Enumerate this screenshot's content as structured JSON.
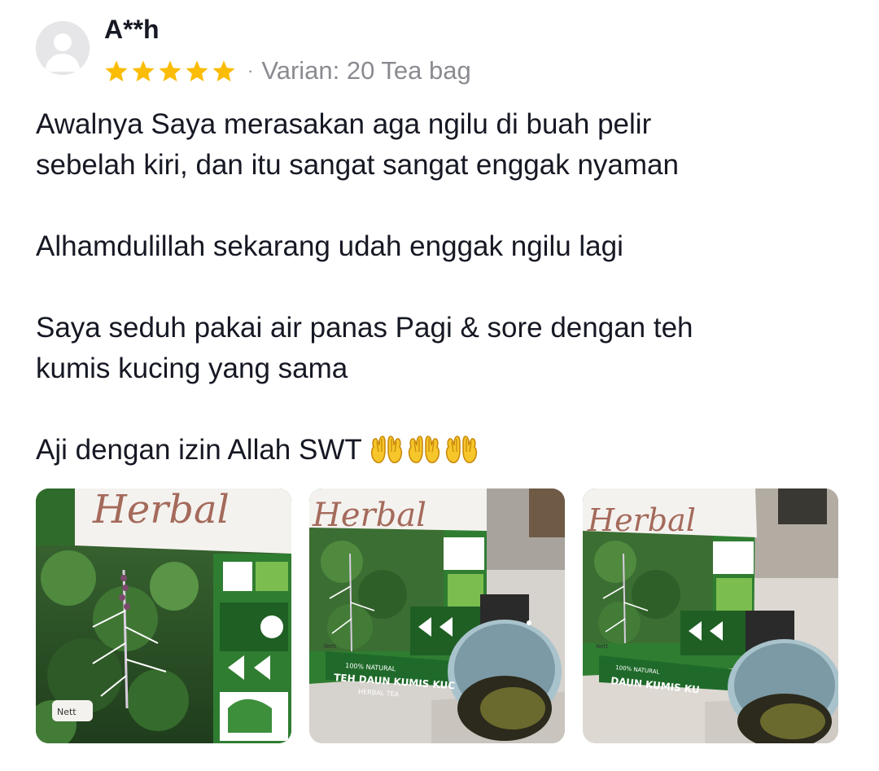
{
  "review": {
    "username": "A**h",
    "rating": 5,
    "rating_max": 5,
    "separator": "·",
    "variant": "Varian: 20 Tea bag",
    "star_color": "#FBBC05",
    "paragraphs": [
      "Awalnya Saya merasakan aga ngilu di buah pelir\nsebelah kiri, dan itu sangat sangat enggak nyaman",
      "Alhamdulillah sekarang udah enggak ngilu lagi",
      "Saya seduh pakai air panas Pagi & sore dengan teh\nkumis kucing yang sama"
    ],
    "last_line": "Aji dengan izin Allah SWT",
    "emoji": [
      "palms-up-together-emoji",
      "palms-up-together-emoji",
      "palms-up-together-emoji"
    ]
  },
  "photos": [
    {
      "icon": "product-photo-pack-closeup",
      "brand_text": "Herbal",
      "small_text": "Nett"
    },
    {
      "icon": "product-photo-pack-with-cup",
      "brand_text": "Herbal",
      "label_line1": "100% NATURAL",
      "label_line2": "TEH DAUN KUMIS KUC",
      "label_line3": "HERBAL TEA",
      "small_text": "Nett"
    },
    {
      "icon": "product-photo-pack-with-cup",
      "brand_text": "Herbal",
      "label_line1": "100% NATURAL",
      "label_line2": "DAUN KUMIS KU",
      "small_text": "Nett"
    }
  ]
}
